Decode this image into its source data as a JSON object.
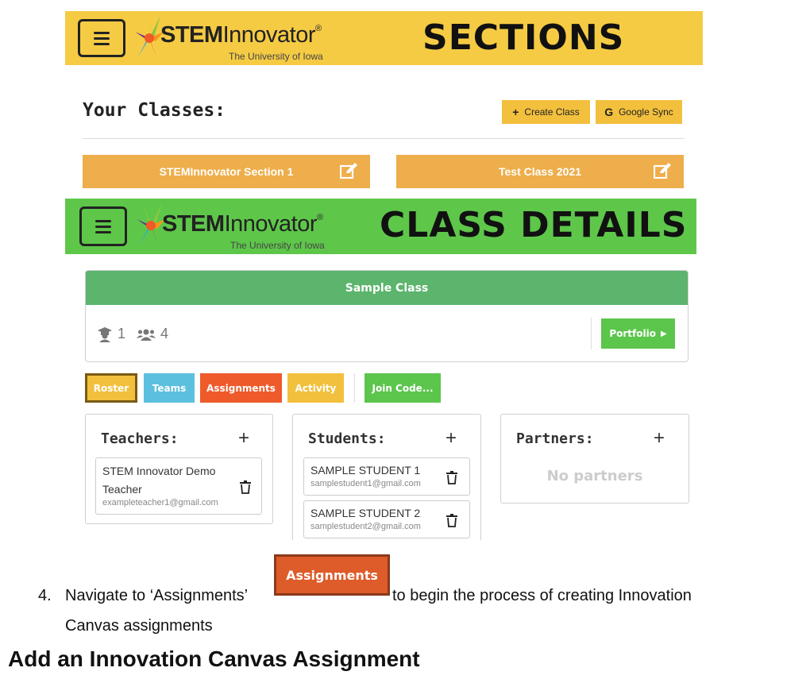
{
  "colors": {
    "sections_banner": "#f5cb44",
    "details_banner": "#5ec74a",
    "class_card": "#eeae4b",
    "panel_header": "#5cb46d",
    "roster": "#f3c03d",
    "teams": "#5bc0de",
    "assignments": "#ee5a2a",
    "activity": "#f3c03d",
    "join_code": "#5cc54c"
  },
  "sections_banner": {
    "logo_bold": "STEM",
    "logo_light": "Innovator",
    "logo_mark": "®",
    "logo_sub": "The University of Iowa",
    "title": "SECTIONS"
  },
  "classes": {
    "heading": "Your Classes:",
    "create_icon": "plus-icon",
    "create_label": "Create Class",
    "sync_icon": "google-icon",
    "sync_glyph": "G",
    "sync_label": "Google Sync",
    "cards": [
      {
        "name": "STEMInnovator Section 1",
        "icon": "edit-icon"
      },
      {
        "name": "Test Class 2021",
        "icon": "edit-icon"
      }
    ]
  },
  "details_banner": {
    "logo_bold": "STEM",
    "logo_light": "Innovator",
    "logo_mark": "®",
    "logo_sub": "The University of Iowa",
    "title": "CLASS DETAILS"
  },
  "class_panel": {
    "title": "Sample Class",
    "teacher_count": "1",
    "student_count": "4",
    "portfolio_label": "Portfolio"
  },
  "tabs": {
    "roster": "Roster",
    "teams": "Teams",
    "assignments": "Assignments",
    "activity": "Activity",
    "join_code": "Join Code..."
  },
  "teachers": {
    "title": "Teachers:",
    "add": "+",
    "items": [
      {
        "name_line1": "STEM Innovator Demo",
        "name_line2": "Teacher",
        "email": "exampleteacher1@gmail.com"
      }
    ]
  },
  "students": {
    "title": "Students:",
    "add": "+",
    "items": [
      {
        "name": "SAMPLE STUDENT 1",
        "email": "samplestudent1@gmail.com"
      },
      {
        "name": "SAMPLE STUDENT 2",
        "email": "samplestudent2@gmail.com"
      }
    ]
  },
  "partners": {
    "title": "Partners:",
    "add": "+",
    "empty": "No partners"
  },
  "step": {
    "number": "4.",
    "text_before": "Navigate to ‘Assignments’",
    "button_label": "Assignments",
    "text_after": "to begin the process of creating Innovation",
    "text_line2": "Canvas assignments"
  },
  "section_heading": "Add an Innovation Canvas Assignment"
}
